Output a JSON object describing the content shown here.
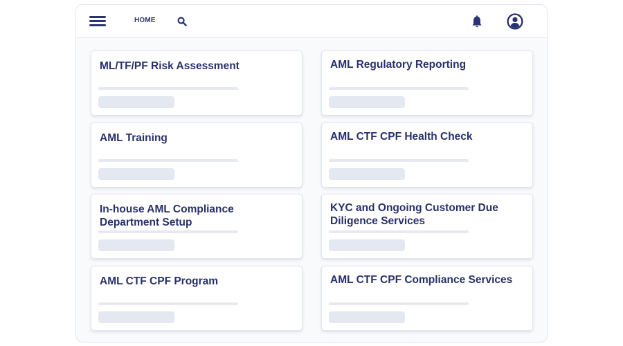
{
  "header": {
    "home_label": "HOME",
    "menu_icon": "hamburger-menu-icon",
    "search_icon": "search-icon",
    "notifications_icon": "bell-icon",
    "account_icon": "user-account-icon"
  },
  "cards": [
    {
      "title": "ML/TF/PF Risk Assessment"
    },
    {
      "title": "AML Regulatory Reporting"
    },
    {
      "title": "AML Training"
    },
    {
      "title": "AML CTF CPF Health Check"
    },
    {
      "title": "In-house AML Compliance Department Setup"
    },
    {
      "title": "KYC and Ongoing Customer Due Diligence Services"
    },
    {
      "title": "AML CTF CPF Program"
    },
    {
      "title": "AML CTF CPF Compliance Services"
    }
  ],
  "colors": {
    "primary_text": "#28306a",
    "placeholder": "#e4e8f0",
    "background": "#f9fafc"
  }
}
